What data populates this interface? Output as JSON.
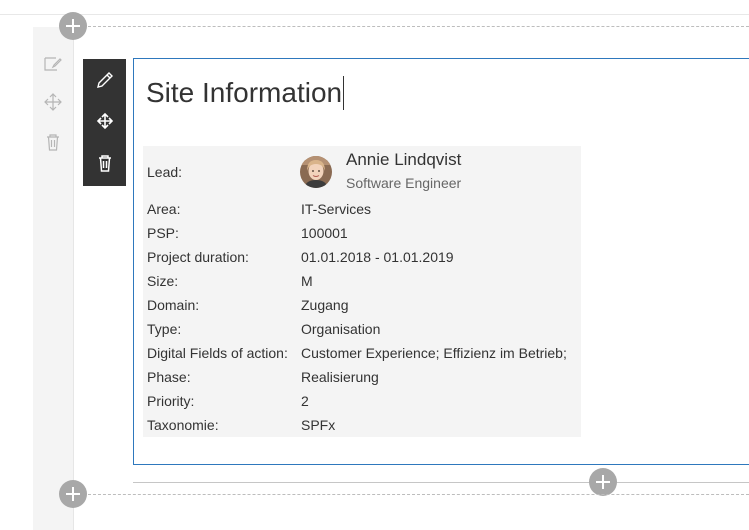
{
  "webpart": {
    "title": "Site Information"
  },
  "lead": {
    "label": "Lead:",
    "name": "Annie Lindqvist",
    "job_title": "Software Engineer"
  },
  "fields": [
    {
      "label": "Area:",
      "value": "IT-Services"
    },
    {
      "label": "PSP:",
      "value": "100001"
    },
    {
      "label": "Project duration:",
      "value": "01.01.2018 - 01.01.2019"
    },
    {
      "label": "Size:",
      "value": "M"
    },
    {
      "label": "Domain:",
      "value": "Zugang"
    },
    {
      "label": "Type:",
      "value": "Organisation"
    },
    {
      "label": "Digital Fields of action:",
      "value": "Customer Experience; Effizienz im Betrieb;"
    },
    {
      "label": "Phase:",
      "value": "Realisierung"
    },
    {
      "label": "Priority:",
      "value": "2"
    },
    {
      "label": "Taxonomie:",
      "value": "SPFx"
    }
  ],
  "icons": {
    "section_edit": "edit-section-icon",
    "section_move": "move-section-icon",
    "section_delete": "delete-section-icon",
    "webpart_edit": "pencil-icon",
    "webpart_move": "move-icon",
    "webpart_delete": "trash-icon",
    "add": "plus-icon"
  },
  "colors": {
    "toolbar_bg": "#333333",
    "frame_border": "#2e78bd",
    "table_bg": "#f4f4f4",
    "add_circle": "#a8a8a8"
  }
}
